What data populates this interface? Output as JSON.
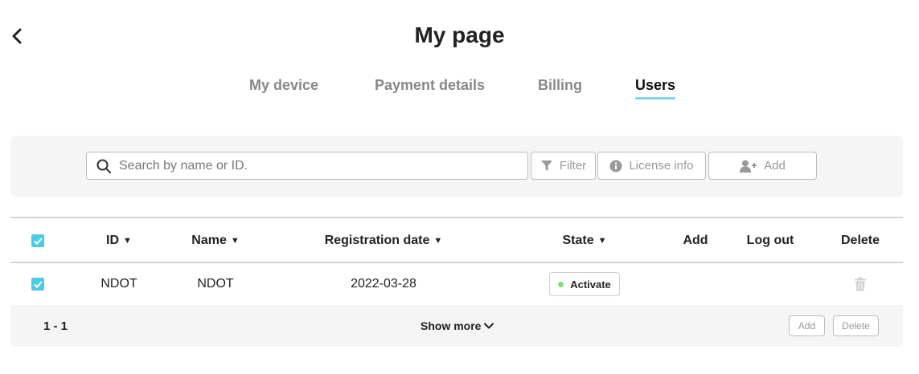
{
  "page": {
    "title": "My page"
  },
  "tabs": [
    {
      "label": "My device",
      "active": false
    },
    {
      "label": "Payment details",
      "active": false
    },
    {
      "label": "Billing",
      "active": false
    },
    {
      "label": "Users",
      "active": true
    }
  ],
  "toolbar": {
    "search_placeholder": "Search by name or ID.",
    "search_value": "",
    "filter_label": "Filter",
    "license_label": "License info",
    "add_label": "Add"
  },
  "table": {
    "header_checked": true,
    "columns": {
      "id": "ID",
      "name": "Name",
      "registration_date": "Registration date",
      "state": "State",
      "add": "Add",
      "logout": "Log out",
      "delete": "Delete"
    },
    "rows": [
      {
        "checked": true,
        "id": "NDOT",
        "name": "NDOT",
        "registration_date": "2022-03-28",
        "state": "Activate",
        "state_color": "#7de07d"
      }
    ]
  },
  "footer": {
    "range": "1 - 1",
    "show_more_label": "Show more",
    "add_label": "Add",
    "delete_label": "Delete"
  },
  "colors": {
    "accent": "#4ec9e6",
    "tab_underline": "#7fd4ee",
    "panel_bg": "#f5f5f5"
  }
}
